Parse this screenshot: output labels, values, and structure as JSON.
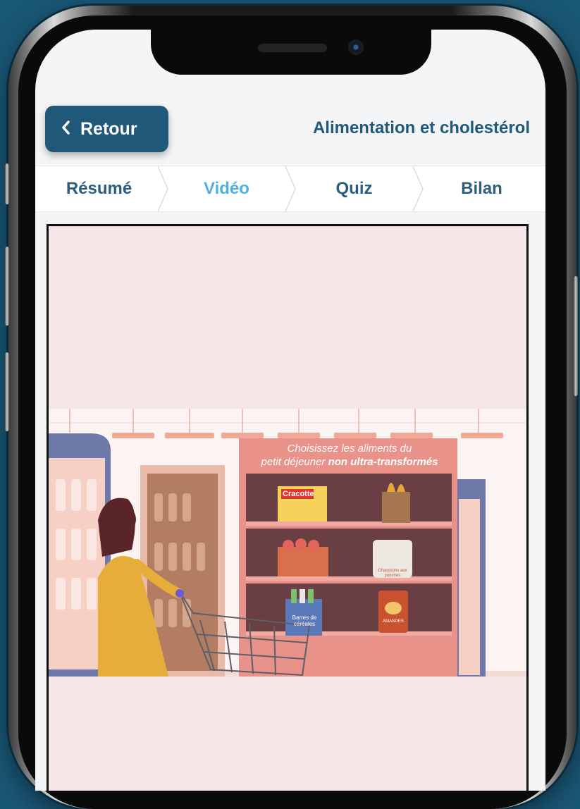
{
  "header": {
    "back_label": "Retour",
    "title": "Alimentation et cholestérol"
  },
  "tabs": [
    {
      "label": "Résumé",
      "active": false
    },
    {
      "label": "Vidéo",
      "active": true
    },
    {
      "label": "Quiz",
      "active": false
    },
    {
      "label": "Bilan",
      "active": false
    }
  ],
  "video": {
    "caption_line1": "Choisissez les aliments du",
    "caption_line2_plain": "petit déjeuner",
    "caption_line2_bold": "non ultra-transformés",
    "products": {
      "cracotte": "Cracotte",
      "chaussons": "Chaussons aux pommes",
      "barres": "Barres de céréales",
      "amandes": "AMANDES"
    }
  },
  "colors": {
    "background": "#1a5877",
    "primary": "#20587a",
    "tab_active": "#4fb0e4",
    "video_bg": "#f6e5e6"
  }
}
